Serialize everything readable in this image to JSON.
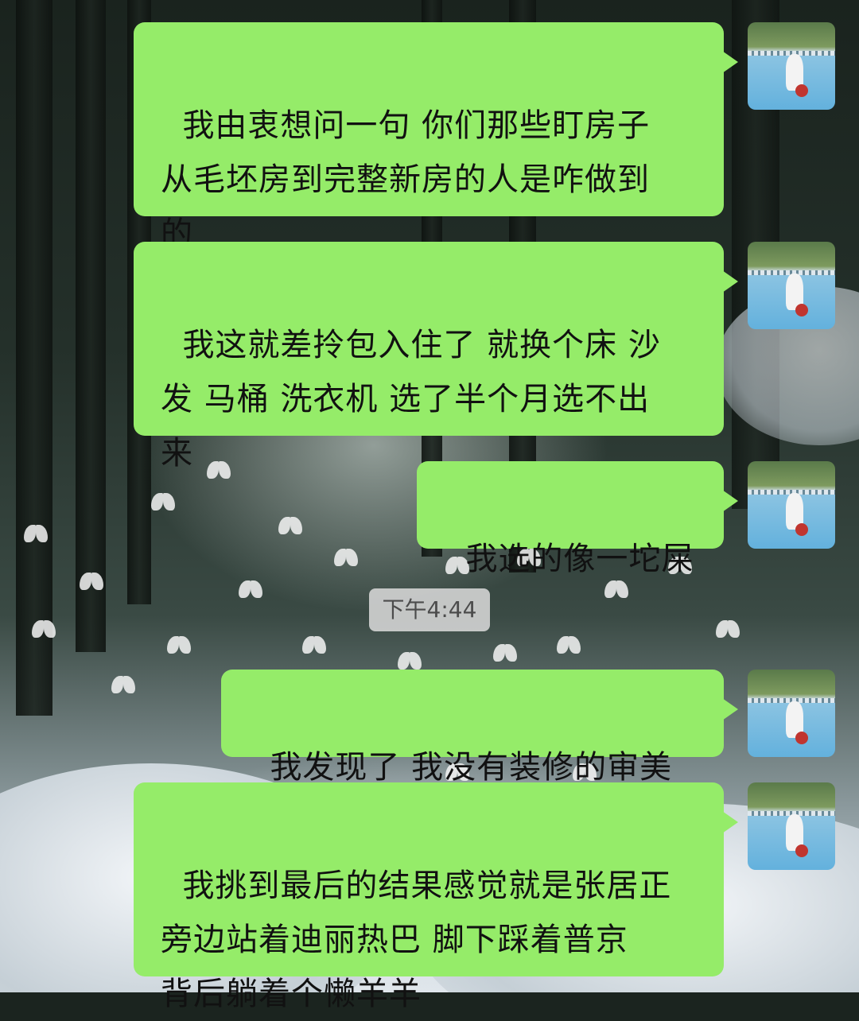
{
  "chat": {
    "messages": [
      {
        "text": "我由衷想问一句 你们那些盯房子\n从毛坯房到完整新房的人是咋做到\n的"
      },
      {
        "text": "我这就差拎包入住了 就换个床 沙\n发 马桶 洗衣机 选了半个月选不出\n来"
      },
      {
        "text": "我选的像一坨屎"
      },
      {
        "text": "我发现了 我没有装修的审美"
      },
      {
        "text": "我挑到最后的结果感觉就是张居正\n旁边站着迪丽热巴 脚下踩着普京\n背后躺着个懒羊羊"
      }
    ],
    "timestamp": "下午4:44"
  },
  "colors": {
    "bubble_self": "#95ec69",
    "timestamp_bg": "#d7d7d7"
  },
  "icons": [
    "user-avatar"
  ]
}
